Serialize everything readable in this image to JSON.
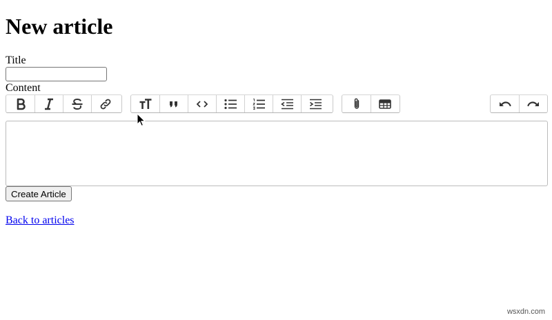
{
  "page": {
    "heading": "New article",
    "title_label": "Title",
    "title_value": "",
    "content_label": "Content",
    "submit_label": "Create Article",
    "back_link": "Back to articles"
  },
  "toolbar": {
    "text_tools": [
      "bold-icon",
      "italic-icon",
      "strikethrough-icon",
      "link-icon"
    ],
    "block_tools": [
      "heading-icon",
      "quote-icon",
      "code-icon",
      "bullet-list-icon",
      "numbered-list-icon",
      "decrease-indent-icon",
      "increase-indent-icon"
    ],
    "file_tools": [
      "attach-file-icon",
      "table-icon"
    ],
    "history_tools": [
      "undo-icon",
      "redo-icon"
    ]
  },
  "watermark": "wsxdn.com"
}
